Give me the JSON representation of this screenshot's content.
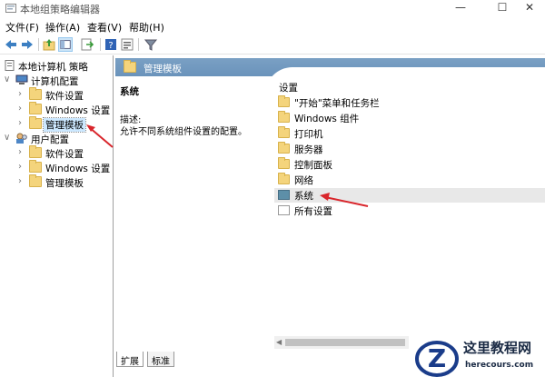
{
  "window": {
    "title": "本地组策略编辑器",
    "controls": {
      "minimize": "—",
      "maximize": "☐",
      "close": "✕"
    }
  },
  "menu": {
    "items": [
      "文件(F)",
      "操作(A)",
      "查看(V)",
      "帮助(H)"
    ]
  },
  "toolbar": {
    "buttons": [
      "back-icon",
      "forward-icon",
      "up-folder-icon",
      "show-hide-tree-icon",
      "export-list-icon",
      "help-icon",
      "properties-icon",
      "filter-icon"
    ]
  },
  "tree": {
    "root": "本地计算机 策略",
    "computer_config": "计算机配置",
    "computer_children": [
      "软件设置",
      "Windows 设置",
      "管理模板"
    ],
    "user_config": "用户配置",
    "user_children": [
      "软件设置",
      "Windows 设置",
      "管理模板"
    ],
    "selected": "管理模板"
  },
  "right_pane": {
    "header": "管理模板",
    "detail_title": "系统",
    "detail_label": "描述:",
    "detail_text": "允许不同系统组件设置的配置。",
    "list_header": "设置",
    "items": [
      "\"开始\"菜单和任务栏",
      "Windows 组件",
      "打印机",
      "服务器",
      "控制面板",
      "网络",
      "系统",
      "所有设置"
    ],
    "highlighted": "系统"
  },
  "tabs": [
    "扩展",
    "标准"
  ],
  "active_tab": "扩展",
  "watermark": {
    "cn": "这里教程网",
    "en": "herecours.com",
    "logo_letter": "Z"
  },
  "colors": {
    "header_bar": "#6f97bf",
    "folder": "#f4d47c",
    "selection": "#cce8ff",
    "arrow": "#d9262c"
  }
}
